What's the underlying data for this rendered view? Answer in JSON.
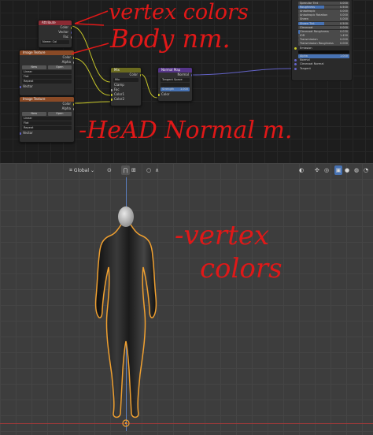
{
  "shader_editor": {
    "attribute_node": {
      "title": "Attribute",
      "outputs": [
        "Color",
        "Vector",
        "Fac"
      ],
      "name_label": "Name:",
      "name_value": "Col"
    },
    "image_texture_body": {
      "title": "Image Texture",
      "outputs": [
        "Color",
        "Alpha"
      ],
      "new_label": "New",
      "open_label": "Open",
      "settings": [
        "Linear",
        "Flat",
        "Repeat",
        "Vector"
      ]
    },
    "image_texture_head": {
      "title": "Image Texture",
      "outputs": [
        "Color",
        "Alpha"
      ],
      "new_label": "New",
      "open_label": "Open",
      "settings": [
        "Linear",
        "Flat",
        "Repeat",
        "Vector"
      ]
    },
    "mix_node": {
      "title": "Mix",
      "output": "Color",
      "mode": "Mix",
      "clamp": "Clamp",
      "inputs": [
        "Fac",
        "Color1",
        "Color2"
      ]
    },
    "normal_map_node": {
      "title": "Normal Map",
      "output": "Normal",
      "space": "Tangent Space",
      "strength_label": "Strength",
      "strength_value": "1.000",
      "input": "Color"
    },
    "bsdf": {
      "properties": [
        {
          "name": "Specular Tint",
          "value": "0.000",
          "fill": 0.0
        },
        {
          "name": "Roughness",
          "value": "0.500",
          "fill": 0.5
        },
        {
          "name": "Anisotropic",
          "value": "0.000",
          "fill": 0.0
        },
        {
          "name": "Anisotropic Rotation",
          "value": "0.000",
          "fill": 0.0
        },
        {
          "name": "Sheen",
          "value": "0.000",
          "fill": 0.0
        },
        {
          "name": "Sheen Tint",
          "value": "0.500",
          "fill": 0.5
        },
        {
          "name": "Clearcoat",
          "value": "0.000",
          "fill": 0.0
        },
        {
          "name": "Clearcoat Roughness",
          "value": "0.030",
          "fill": 0.03
        },
        {
          "name": "IOR",
          "value": "1.450",
          "fill": 0.0
        },
        {
          "name": "Transmission",
          "value": "0.000",
          "fill": 0.0
        },
        {
          "name": "Transmission Roughness",
          "value": "0.000",
          "fill": 0.0
        }
      ],
      "emission_label": "Emission",
      "alpha": {
        "name": "Alpha",
        "value": "1.000",
        "fill": 1.0
      },
      "sockets": [
        "Normal",
        "Clearcoat Normal",
        "Tangent"
      ]
    }
  },
  "annotations": {
    "vertex_colors_top": "vertex colors",
    "body_nm": "Body nm.",
    "head_normal_m": "-HeAD Normal m.",
    "vertex_colors_viewport_line1": "-vertex",
    "vertex_colors_viewport_line2": "colors"
  },
  "viewport_header": {
    "orientation": "Global"
  },
  "colors": {
    "annotation_red": "#e01818",
    "attribute_header": "#8a2a33",
    "image_texture_header": "#8a4a26",
    "mix_header": "#6b6b1f",
    "normal_map_header": "#56358a",
    "selection_outline": "#f0a030",
    "blender_blue": "#4772b3"
  }
}
